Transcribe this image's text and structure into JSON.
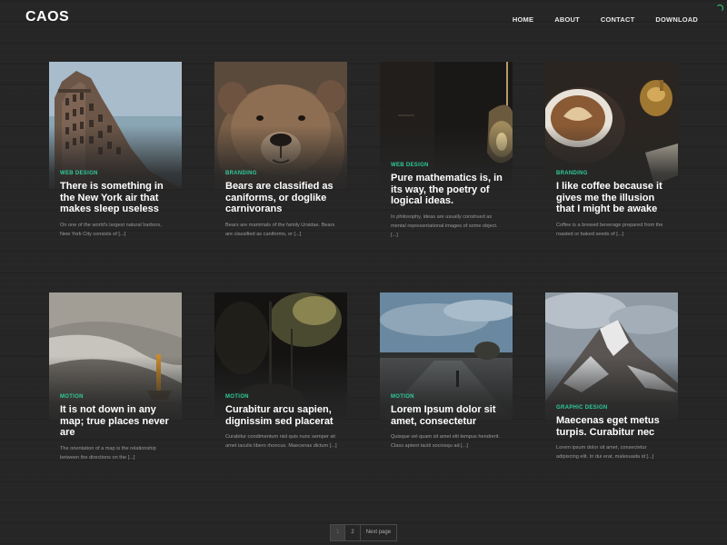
{
  "site": {
    "logo": "CAOS"
  },
  "nav": [
    "HOME",
    "ABOUT",
    "CONTACT",
    "DOWNLOAD"
  ],
  "posts": [
    {
      "category": "WEB DESIGN",
      "title": "There is something in the New York air that makes sleep useless",
      "excerpt": "On one of the world's largest natural harbors, New York City consists of [...]",
      "image": "flatiron-building"
    },
    {
      "category": "BRANDING",
      "title": "Bears are classified as caniforms, or doglike carnivorans",
      "excerpt": "Bears are mammals of the family Ursidae. Bears are classified as caniforms, or [...]",
      "image": "bear"
    },
    {
      "category": "WEB DESIGN",
      "title": "Pure mathematics is, in its way, the poetry of logical ideas.",
      "excerpt": "In philosophy, ideas are usually construed as mental representational images of some object. [...]",
      "image": "hanging-lamp"
    },
    {
      "category": "BRANDING",
      "title": "I like coffee because it gives me the illusion that I might be awake",
      "excerpt": "Coffee is a brewed beverage prepared from the roasted or baked seeds of [...]",
      "image": "coffee-cup"
    },
    {
      "category": "MOTION",
      "title": "It is not down in any map; true places never are",
      "excerpt": "The orientation of a map is the relationship between the directions on the [...]",
      "image": "foggy-sea"
    },
    {
      "category": "MOTION",
      "title": "Curabitur arcu sapien, dignissim sed placerat",
      "excerpt": "Curabitur condimentum nisl quis nunc semper sit amet iaculis libero rhoncus. Maecenas dictum [...]",
      "image": "trees-night"
    },
    {
      "category": "MOTION",
      "title": "Lorem Ipsum dolor sit amet, consectetur",
      "excerpt": "Quisque vel quam sit amet elit tempus hendrerit. Class aptent taciti sociosqu ad [...]",
      "image": "wet-road"
    },
    {
      "category": "GRAPHIC DESIGN",
      "title": "Maecenas eget metus turpis. Curabitur nec",
      "excerpt": "Lorem ipsum dolor sit amet, consectetur adipiscing elit. In dui erat, malesuada id [...]",
      "image": "matterhorn"
    }
  ],
  "pagination": {
    "pages": [
      "1",
      "2"
    ],
    "current": "1",
    "next_label": "Next page"
  },
  "colors": {
    "accent": "#2ecc9a",
    "background": "#262626"
  }
}
